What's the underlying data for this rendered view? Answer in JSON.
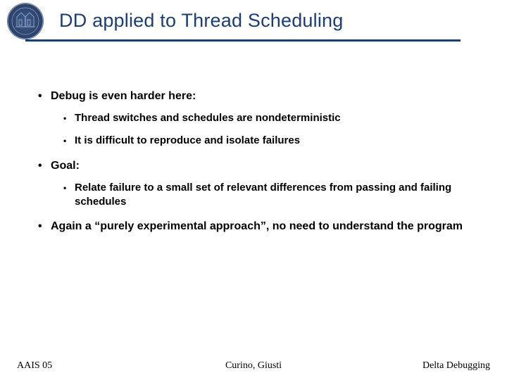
{
  "title": "DD applied to Thread Scheduling",
  "bullets": {
    "a": {
      "text": "Debug is even harder here:",
      "sub": [
        "Thread switches and schedules are nondeterministic",
        "It is difficult to reproduce and isolate failures"
      ]
    },
    "b": {
      "text": "Goal:",
      "sub": [
        "Relate failure to a small set of relevant differences from passing and failing schedules"
      ]
    },
    "c": {
      "text": "Again a “purely experimental approach”, no need to understand the program"
    }
  },
  "footer": {
    "left": "AAIS 05",
    "center": "Curino, Giusti",
    "right": "Delta Debugging"
  }
}
